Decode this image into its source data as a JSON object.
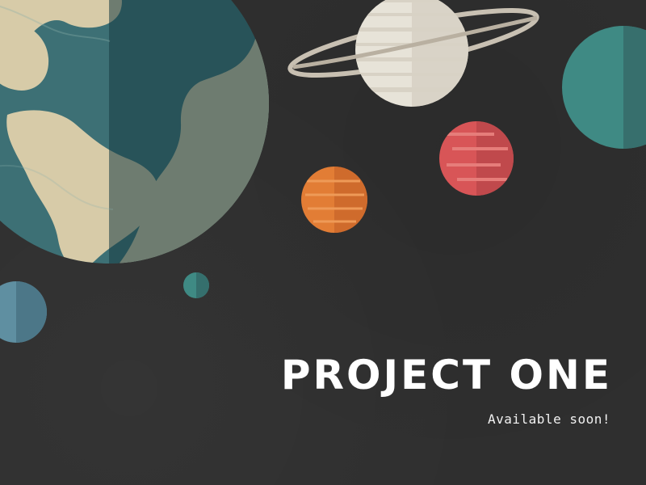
{
  "poster": {
    "title": "PROJECT ONE",
    "subtitle": "Available soon!"
  },
  "colors": {
    "background": "#2f2f2f",
    "ocean": "#3d7075",
    "land": "#d7cba8",
    "teal_planet": "#3f8a84",
    "red_planet": "#d85557",
    "orange_planet": "#e27d35",
    "ringed_planet": "#e2ddd1",
    "blue_planet": "#5f8fa1",
    "text": "#ffffff"
  },
  "icons": {
    "earth": "earth-planet-icon",
    "ringed": "ringed-planet-icon",
    "teal": "teal-planet-icon",
    "red": "red-planet-icon",
    "orange": "orange-planet-icon",
    "small_teal": "small-teal-moon-icon",
    "blue": "blue-planet-icon"
  }
}
